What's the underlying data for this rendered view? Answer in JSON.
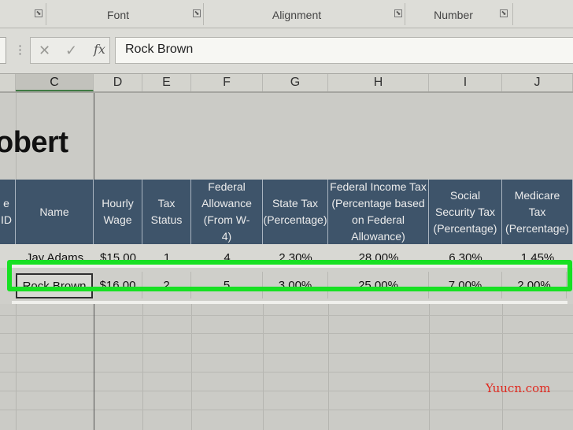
{
  "ribbon": {
    "groups": [
      "Font",
      "Alignment",
      "Number"
    ],
    "launcher_glyph": "⬊"
  },
  "formula_bar": {
    "cancel_glyph": "✕",
    "enter_glyph": "✓",
    "fx_label": "fx",
    "dots": "⋮",
    "value": "Rock Brown"
  },
  "columns": [
    "C",
    "D",
    "E",
    "F",
    "G",
    "H",
    "I",
    "J"
  ],
  "selected_column": "C",
  "title_fragment": "obert",
  "table": {
    "headers": [
      "e ID",
      "Name",
      "Hourly Wage",
      "Tax Status",
      "Federal Allowance (From W-4)",
      "State Tax (Percentage)",
      "Federal Income Tax (Percentage based on Federal Allowance)",
      "Social Security Tax (Percentage)",
      "Medicare Tax (Percentage)"
    ],
    "row1": [
      "Jay Adams",
      "$15.00",
      "1",
      "4",
      "2.30%",
      "28.00%",
      "6.30%",
      "1.45%"
    ],
    "row2": [
      "Rock Brown",
      "$16.00",
      "2",
      "5",
      "3.00%",
      "25.00%",
      "7.00%",
      "2.00%"
    ]
  },
  "highlight_color": "#18e023",
  "header_fill_color": "#3e546a",
  "watermark": "Yuucn.com"
}
